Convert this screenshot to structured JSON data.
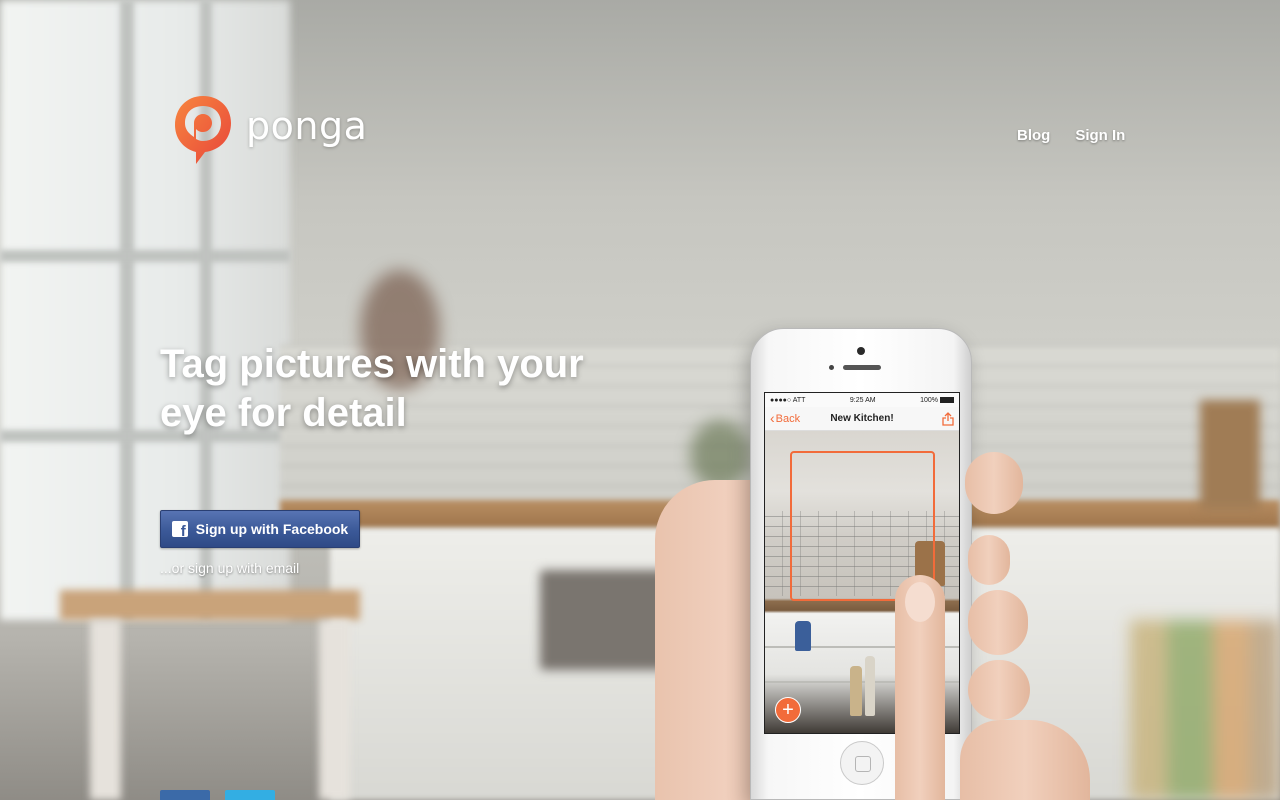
{
  "brand": {
    "name": "ponga",
    "accent": "#f26b3a"
  },
  "nav": {
    "blog": "Blog",
    "sign_in": "Sign In"
  },
  "hero": {
    "headline_line1": "Tag pictures with your",
    "headline_line2": "eye for detail",
    "facebook_button": "Sign up with Facebook",
    "email_link": "...or sign up with email"
  },
  "phone": {
    "carrier": "●●●●○ ATT",
    "time": "9:25 AM",
    "battery": "100%",
    "back_label": "Back",
    "screen_title": "New Kitchen!",
    "add_glyph": "+"
  },
  "icons": {
    "logo": "ponga-logo-icon",
    "facebook": "facebook-icon",
    "back": "chevron-left-icon",
    "share": "share-icon",
    "add": "plus-icon"
  },
  "colors": {
    "facebook_blue": "#3b5998",
    "white": "#ffffff"
  }
}
